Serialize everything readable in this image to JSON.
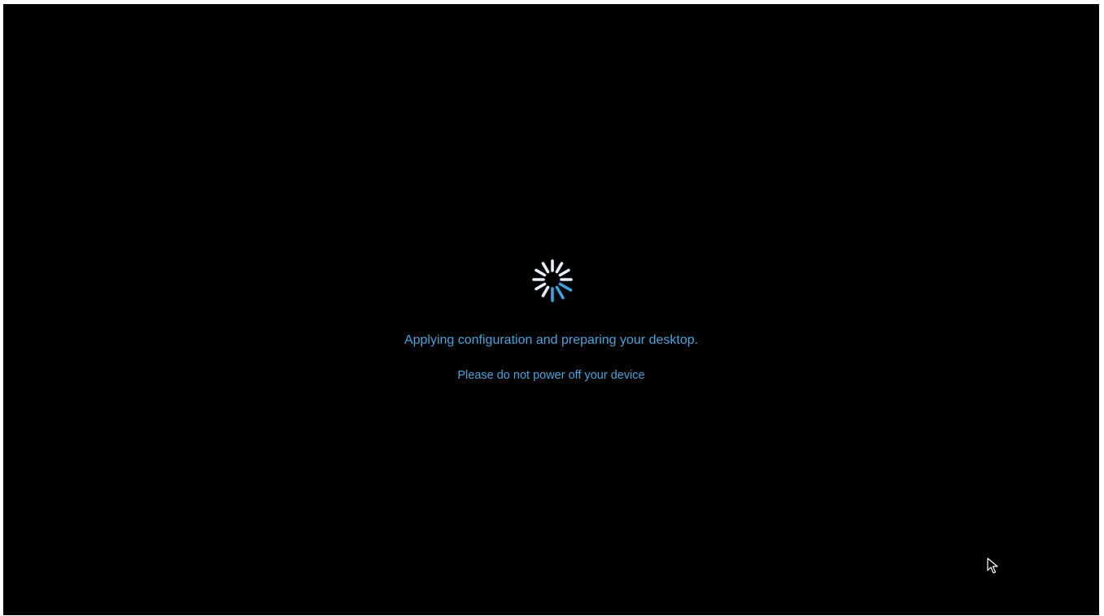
{
  "status": {
    "message": "Applying configuration and preparing your desktop.",
    "warning": "Please do not power off your device"
  },
  "colors": {
    "background": "#000000",
    "text": "#4aa3d9",
    "spinner_light": "#e6f1fa",
    "spinner_accent": "#3ea2e0"
  },
  "icons": {
    "spinner": "loading-spinner-icon",
    "cursor": "mouse-pointer-icon"
  }
}
